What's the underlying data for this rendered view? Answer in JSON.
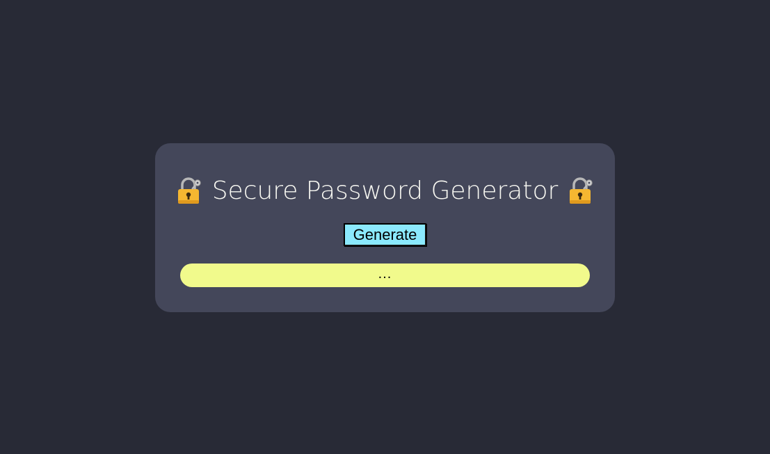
{
  "app": {
    "title": "Secure Password Generator",
    "lock_icon_left": "padlock-with-key-icon",
    "lock_icon_right": "padlock-with-key-icon"
  },
  "controls": {
    "generate_label": "Generate"
  },
  "output": {
    "value": "..."
  },
  "colors": {
    "background": "#282a36",
    "card": "#44475a",
    "title": "#f8f8f2",
    "button": "#8be9fd",
    "output": "#f1fa8c",
    "lock": "#f5b731"
  }
}
